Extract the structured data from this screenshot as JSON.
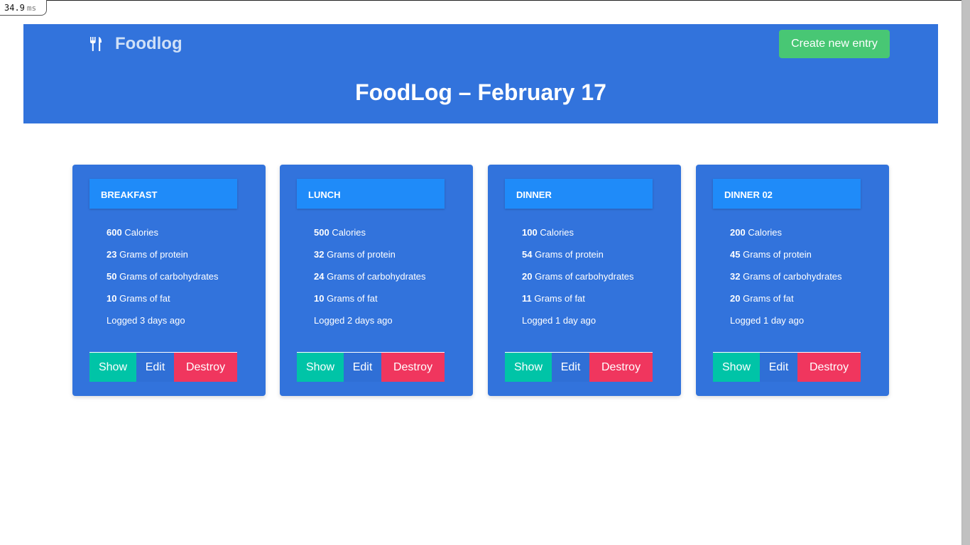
{
  "perf": {
    "value": "34.9",
    "unit": "ms"
  },
  "navbar": {
    "brand_icon": "utensils-icon",
    "brand": "Foodlog",
    "create_label": "Create new entry"
  },
  "hero": {
    "title": "FoodLog – February 17"
  },
  "colors": {
    "primary": "#3273dc",
    "header": "#1f8bf9",
    "success": "#48c774",
    "show": "#00c4a7",
    "danger": "#f0365e"
  },
  "entries": [
    {
      "title": "BREAKFAST",
      "calories": "600",
      "calories_label": "Calories",
      "protein": "23",
      "protein_label": "Grams of protein",
      "carbs": "50",
      "carbs_label": "Grams of carbohydrates",
      "fat": "10",
      "fat_label": "Grams of fat",
      "logged": "Logged 3 days ago",
      "show": "Show",
      "edit": "Edit",
      "destroy": "Destroy"
    },
    {
      "title": "LUNCH",
      "calories": "500",
      "calories_label": "Calories",
      "protein": "32",
      "protein_label": "Grams of protein",
      "carbs": "24",
      "carbs_label": "Grams of carbohydrates",
      "fat": "10",
      "fat_label": "Grams of fat",
      "logged": "Logged 2 days ago",
      "show": "Show",
      "edit": "Edit",
      "destroy": "Destroy"
    },
    {
      "title": "DINNER",
      "calories": "100",
      "calories_label": "Calories",
      "protein": "54",
      "protein_label": "Grams of protein",
      "carbs": "20",
      "carbs_label": "Grams of carbohydrates",
      "fat": "11",
      "fat_label": "Grams of fat",
      "logged": "Logged 1 day ago",
      "show": "Show",
      "edit": "Edit",
      "destroy": "Destroy"
    },
    {
      "title": "DINNER 02",
      "calories": "200",
      "calories_label": "Calories",
      "protein": "45",
      "protein_label": "Grams of protein",
      "carbs": "32",
      "carbs_label": "Grams of carbohydrates",
      "fat": "20",
      "fat_label": "Grams of fat",
      "logged": "Logged 1 day ago",
      "show": "Show",
      "edit": "Edit",
      "destroy": "Destroy"
    }
  ]
}
